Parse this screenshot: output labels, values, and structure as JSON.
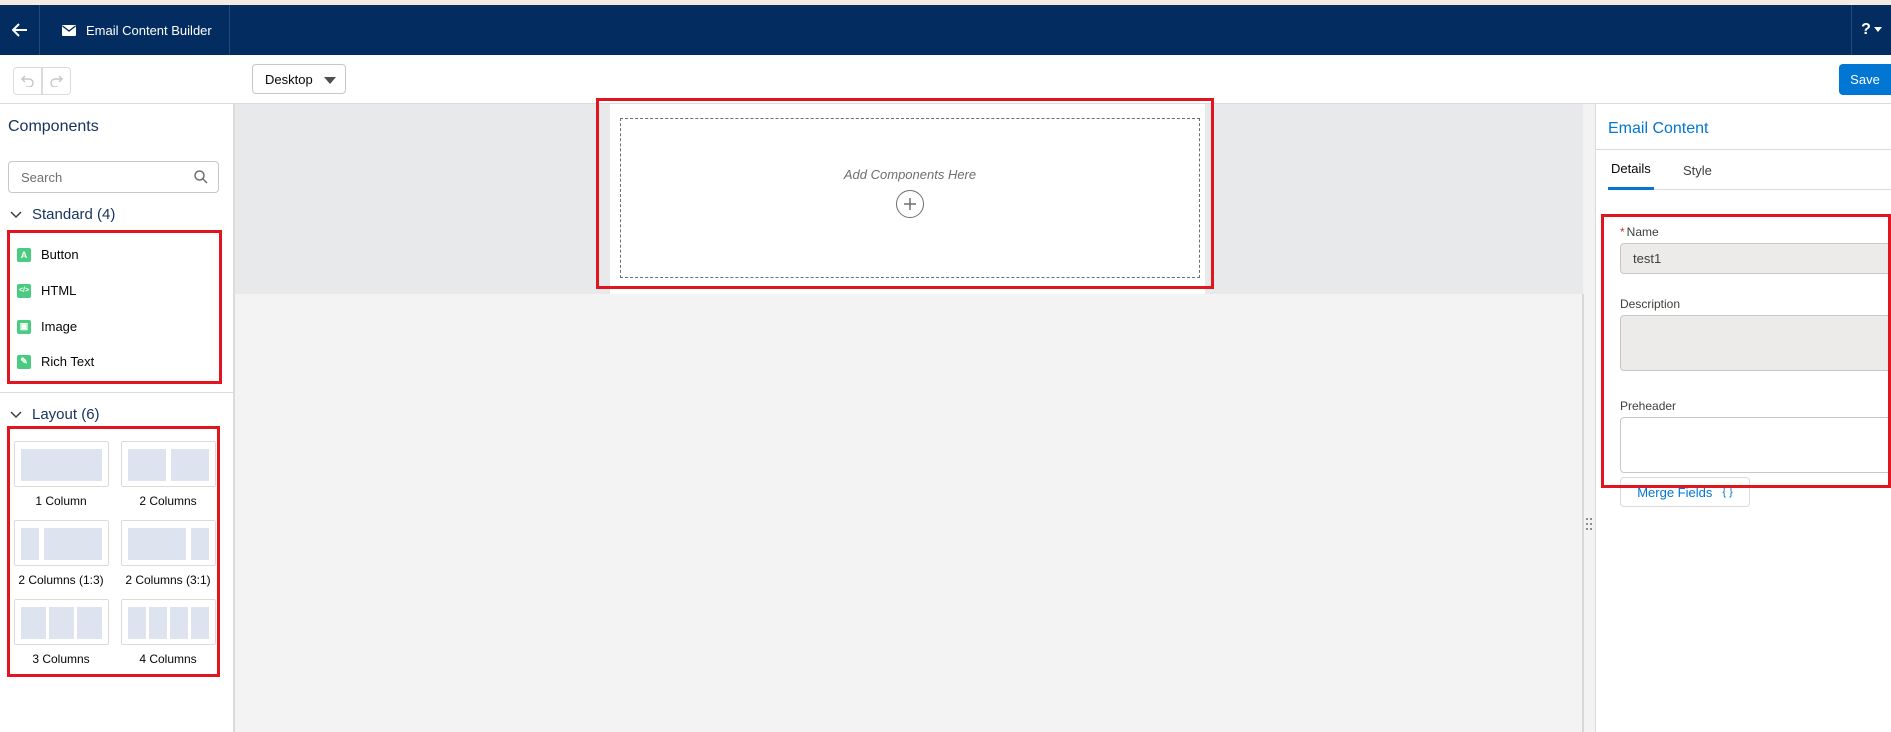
{
  "header": {
    "app_title": "Email Content Builder",
    "help_label": "?"
  },
  "toolbar": {
    "device_select": "Desktop",
    "save_label": "Save"
  },
  "components_panel": {
    "title": "Components",
    "search_placeholder": "Search",
    "standard_header": "Standard (4)",
    "standard_items": [
      {
        "label": "Button",
        "icon": "button-icon",
        "glyph": "A"
      },
      {
        "label": "HTML",
        "icon": "html-icon",
        "glyph": "</>"
      },
      {
        "label": "Image",
        "icon": "image-icon",
        "glyph": "▣"
      },
      {
        "label": "Rich Text",
        "icon": "rich-text-icon",
        "glyph": "✎"
      }
    ],
    "layout_header": "Layout (6)",
    "layout_items": [
      {
        "label": "1 Column"
      },
      {
        "label": "2 Columns"
      },
      {
        "label": "2 Columns (1:3)"
      },
      {
        "label": "2 Columns (3:1)"
      },
      {
        "label": "3 Columns"
      },
      {
        "label": "4 Columns"
      }
    ]
  },
  "canvas": {
    "dropzone_text": "Add Components Here"
  },
  "properties_panel": {
    "title": "Email Content",
    "tabs": [
      {
        "label": "Details",
        "active": true
      },
      {
        "label": "Style",
        "active": false
      }
    ],
    "name_label": "Name",
    "name_required": "*",
    "name_value": "test1",
    "description_label": "Description",
    "description_value": "",
    "preheader_label": "Preheader",
    "preheader_value": "",
    "merge_fields_label": "Merge Fields",
    "merge_fields_glyph": "{ }"
  },
  "colors": {
    "header_bg": "#032d60",
    "brand_blue": "#0176d3",
    "component_icon_green": "#4bca81",
    "annotation_red": "#e0151f"
  }
}
